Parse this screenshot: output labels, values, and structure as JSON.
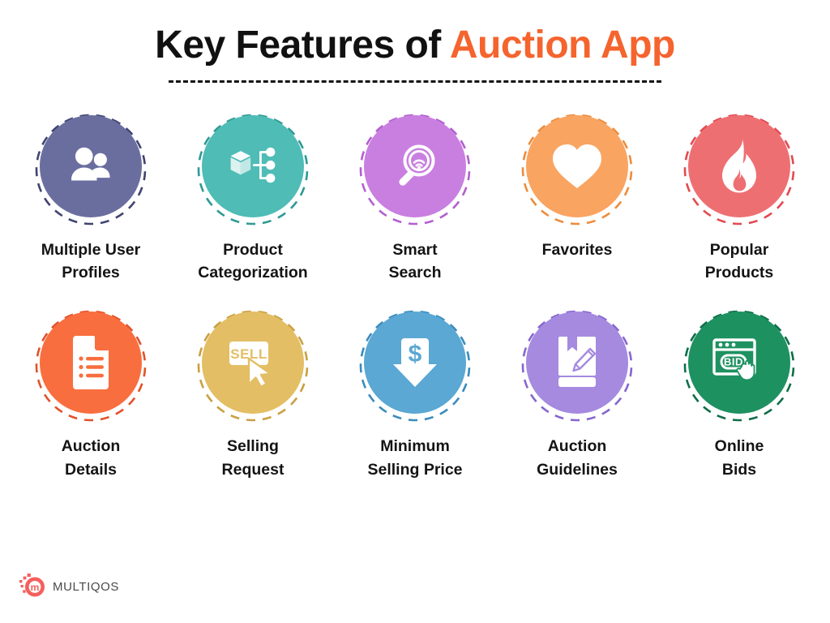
{
  "header": {
    "title_main": "Key Features of ",
    "title_accent": "Auction App",
    "accent_color": "#F5642E",
    "underline": "dashed-divider"
  },
  "features": [
    {
      "label": "Multiple User\nProfiles",
      "icon": "users-icon",
      "color": "#6A6E9F",
      "dash_color": "#3F4470"
    },
    {
      "label": "Product\nCategorization",
      "icon": "product-category-icon",
      "color": "#4FBCB6",
      "dash_color": "#2E9A94"
    },
    {
      "label": "Smart\nSearch",
      "icon": "smart-search-icon",
      "color": "#C97FE0",
      "dash_color": "#B25FD0"
    },
    {
      "label": "Favorites",
      "icon": "heart-icon",
      "color": "#F9A461",
      "dash_color": "#ED8C3C"
    },
    {
      "label": "Popular\nProducts",
      "icon": "flame-icon",
      "color": "#EE6F72",
      "dash_color": "#E24A50"
    },
    {
      "label": "Auction\nDetails",
      "icon": "document-list-icon",
      "color": "#F96E3E",
      "dash_color": "#E2522A"
    },
    {
      "label": "Selling\nRequest",
      "icon": "sell-cursor-icon",
      "color": "#E3BE64",
      "dash_color": "#C9A042"
    },
    {
      "label": "Minimum\nSelling Price",
      "icon": "dollar-down-arrow-icon",
      "color": "#5AA8D3",
      "dash_color": "#3A8BBC"
    },
    {
      "label": "Auction\nGuidelines",
      "icon": "book-pencil-icon",
      "color": "#A58AE0",
      "dash_color": "#8566CE"
    },
    {
      "label": "Online\nBids",
      "icon": "bid-click-icon",
      "color": "#1E9161",
      "dash_color": "#0E6E47"
    }
  ],
  "footer": {
    "brand": "MULTIQOS",
    "brand_mark_letter": "m",
    "brand_color": "#F4605C"
  }
}
